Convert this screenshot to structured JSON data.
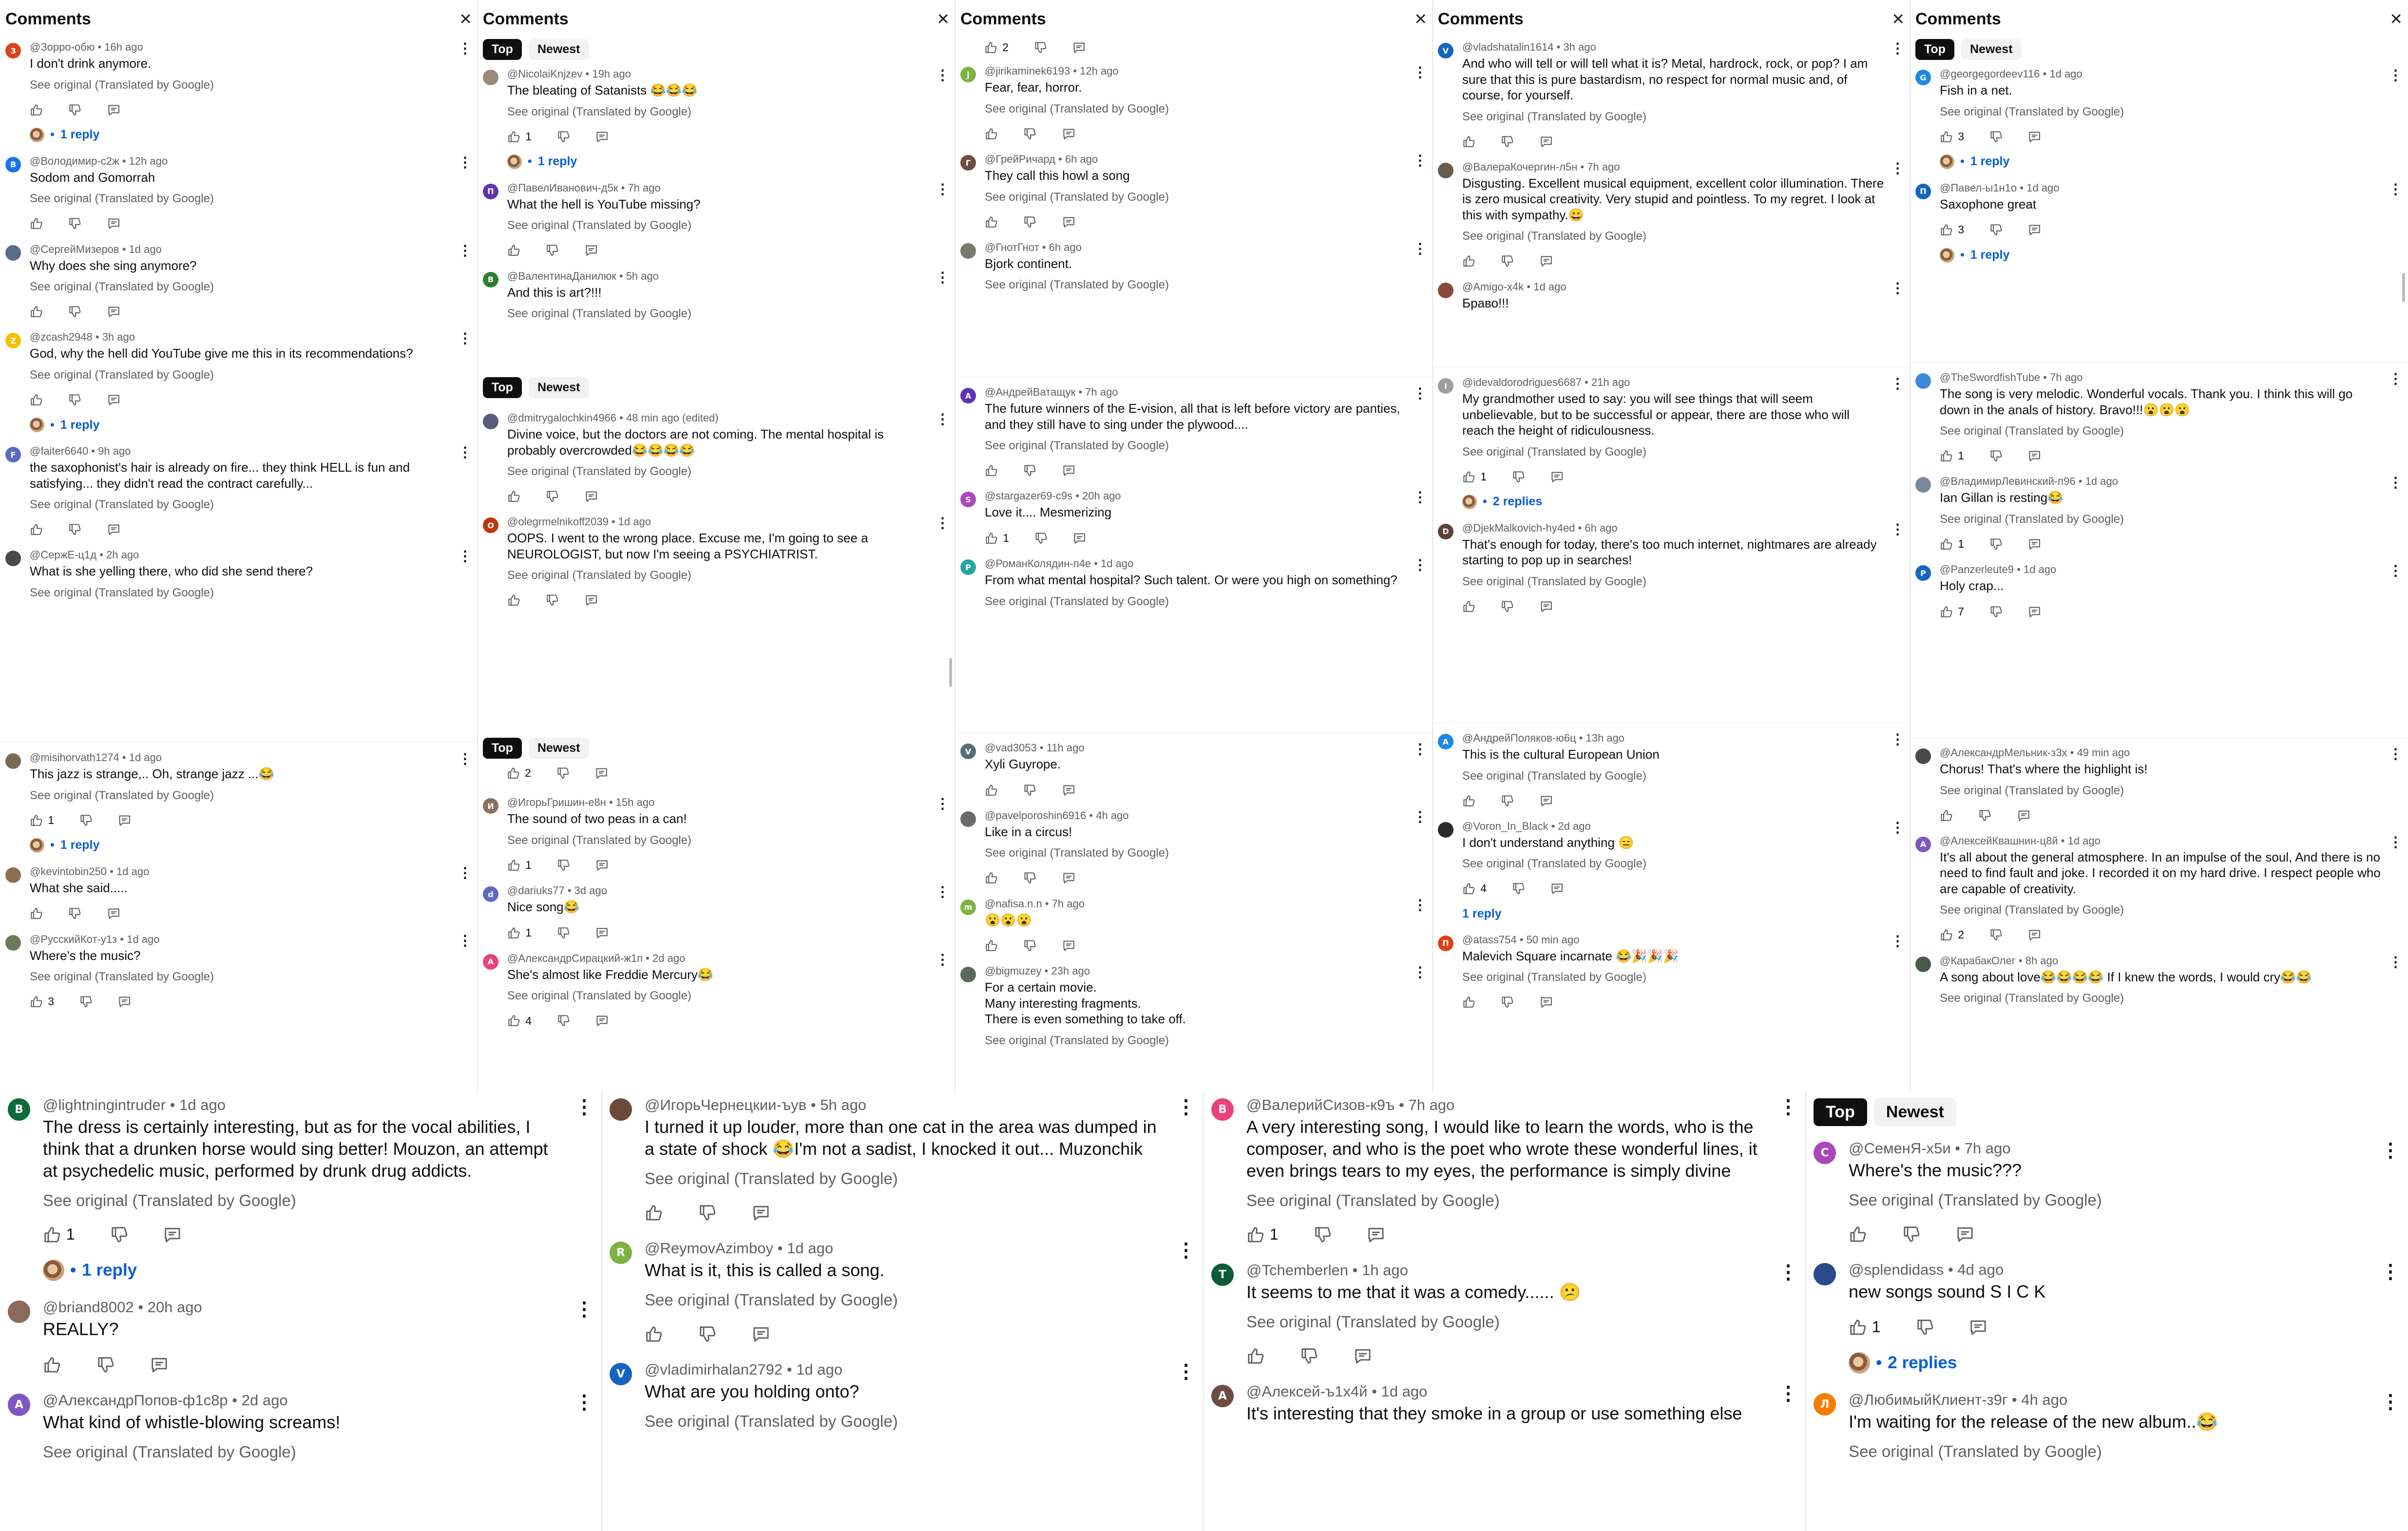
{
  "header": {
    "title": "Comments",
    "tabs": [
      "Top",
      "Newest"
    ]
  },
  "ui": {
    "see_original": "See original (Translated by Google)"
  },
  "accents": {
    "link": "#065fd4",
    "meta": "#606060",
    "active_tab": "#0f0f0f"
  },
  "panels": [
    {
      "comments": [
        {
          "author": "@Зорро-обю",
          "time": "16h ago",
          "text": "I don't drink anymore.",
          "initial": "З",
          "color": "#d9441c",
          "likes": "",
          "replies": "1 reply"
        },
        {
          "author": "@Володимир-с2ж",
          "time": "12h ago",
          "text": "Sodom and Gomorrah",
          "initial": "В",
          "color": "#1a73e8",
          "likes": "",
          "replies": ""
        },
        {
          "author": "@СергейМизеров",
          "time": "1d ago",
          "text": "Why does she sing anymore?",
          "initial": "",
          "color": "#5b6b8a",
          "likes": "",
          "replies": ""
        },
        {
          "author": "@zcash2948",
          "time": "3h ago",
          "text": "God, why the hell did YouTube give me this in its recommendations?",
          "initial": "Z",
          "color": "#f2c200",
          "likes": "",
          "replies": "1 reply"
        },
        {
          "author": "@faiter6640",
          "time": "9h ago",
          "text": "the saxophonist's hair is already on fire... they think HELL is fun and satisfying... they didn't read the contract carefully...",
          "initial": "F",
          "color": "#5c6bc0",
          "likes": "",
          "replies": ""
        },
        {
          "author": "@СержЕ-ц1д",
          "time": "2h ago",
          "text": "What is she yelling there, who did she send there?",
          "initial": "",
          "color": "#4a4a4a",
          "likes": "",
          "replies": "",
          "no_actions": true
        }
      ]
    },
    {
      "comments": [
        {
          "author": "@misihorvath1274",
          "time": "1d ago",
          "text": "This jazz is strange,.. Oh, strange jazz ...😂",
          "initial": "",
          "color": "#7a6a55",
          "likes": "1",
          "replies": "1 reply"
        },
        {
          "author": "@kevintobin250",
          "time": "1d ago",
          "text": "What she said.....",
          "initial": "",
          "color": "#8a7050",
          "likes": "",
          "replies": "",
          "no_see": true
        },
        {
          "author": "@РусскийКот-у1з",
          "time": "1d ago",
          "text": "Where's the music?",
          "initial": "",
          "color": "#6b7b5a",
          "likes": "3",
          "replies": ""
        }
      ]
    },
    {
      "comments": [
        {
          "author": "@NicolaiKnjzev",
          "time": "19h ago",
          "text": "The bleating of Satanists 😂😂😂",
          "initial": "",
          "color": "#9a8a7a",
          "likes": "1",
          "replies": "1 reply"
        },
        {
          "author": "@ПавелИванович-д5к",
          "time": "7h ago",
          "text": "What the hell is YouTube missing?",
          "initial": "П",
          "color": "#5e35b1",
          "likes": "",
          "replies": ""
        },
        {
          "author": "@ВалентинаДанилюк",
          "time": "5h ago",
          "text": "And this is art?!!!",
          "initial": "В",
          "color": "#2e7d32",
          "likes": "",
          "replies": "",
          "no_actions": true
        }
      ]
    },
    {
      "comments": [
        {
          "author": "@dmitrygalochkin4966",
          "time": "48 min ago (edited)",
          "text": "Divine voice, but the doctors are not coming. The mental hospital is probably overcrowded😂😂😂😂",
          "initial": "",
          "color": "#5a5a7a",
          "likes": "",
          "replies": ""
        },
        {
          "author": "@olegrmelnikoff2039",
          "time": "1d ago",
          "text": "OOPS. I went to the wrong place. Excuse me, I'm going to see a NEUROLOGIST, but now I'm seeing a PSYCHIATRIST.",
          "initial": "O",
          "color": "#bf360c",
          "likes": "",
          "replies": ""
        }
      ]
    },
    {
      "top_likes": "2",
      "comments": [
        {
          "author": "@ИгорьГришин-е8н",
          "time": "15h ago",
          "text": "The sound of two peas in a can!",
          "initial": "И",
          "color": "#8d6e63",
          "likes": "1",
          "replies": ""
        },
        {
          "author": "@dariuks77",
          "time": "3d ago",
          "text": "Nice song😂",
          "initial": "d",
          "color": "#5c6bc0",
          "likes": "1",
          "replies": "",
          "no_see": true
        },
        {
          "author": "@АлександрСирацкий-ж1п",
          "time": "2d ago",
          "text": "She's almost like Freddie Mercury😂",
          "initial": "А",
          "color": "#ec407a",
          "likes": "4",
          "replies": ""
        }
      ]
    },
    {
      "top_likes": "2",
      "comments": [
        {
          "author": "@jirikaminek6193",
          "time": "12h ago",
          "text": "Fear, fear, horror.",
          "initial": "j",
          "color": "#7cb342",
          "likes": "",
          "replies": ""
        },
        {
          "author": "@ГрейРичард",
          "time": "6h ago",
          "text": "They call this howl a song",
          "initial": "Г",
          "color": "#6d4c41",
          "likes": "",
          "replies": ""
        },
        {
          "author": "@ГнотГнот",
          "time": "6h ago",
          "text": "Bjork continent.",
          "initial": "",
          "color": "#7a7a6a",
          "likes": "",
          "replies": "",
          "no_actions": true
        }
      ]
    },
    {
      "comments": [
        {
          "author": "@АндрейВатащук",
          "time": "7h ago",
          "text": "The future winners of the E-vision, all that is left before victory are panties, and they still have to sing under the plywood....",
          "initial": "А",
          "color": "#5e35b1",
          "likes": "",
          "replies": ""
        },
        {
          "author": "@stargazer69-c9s",
          "time": "20h ago",
          "text": "Love it....      Mesmerizing",
          "initial": "S",
          "color": "#ab47bc",
          "likes": "1",
          "replies": "",
          "no_see": true
        },
        {
          "author": "@РоманКолядин-п4е",
          "time": "1d ago",
          "text": "From what mental hospital? Such talent. Or were you high on something?",
          "initial": "Р",
          "color": "#26a69a",
          "likes": "",
          "replies": "",
          "no_actions": true
        }
      ]
    },
    {
      "comments": [
        {
          "author": "@vad3053",
          "time": "11h ago",
          "text": "Xyli Guyrope.",
          "initial": "V",
          "color": "#546e7a",
          "likes": "",
          "replies": "",
          "no_see": true
        },
        {
          "author": "@pavelporoshin6916",
          "time": "4h ago",
          "text": "Like in a circus!",
          "initial": "",
          "color": "#6a6a6a",
          "likes": "",
          "replies": ""
        },
        {
          "author": "@nafisa.n.n",
          "time": "7h ago",
          "text": "😮😮😮",
          "initial": "m",
          "color": "#7cb342",
          "likes": "",
          "replies": "",
          "no_see": true
        },
        {
          "author": "@bigmuzey",
          "time": "23h ago",
          "text": "For a certain movie.\nMany interesting fragments.\nThere is even something to take off.",
          "initial": "",
          "color": "#5a6a5a",
          "likes": "",
          "replies": "",
          "no_actions": true
        }
      ]
    },
    {
      "comments": [
        {
          "author": "@vladshatalin1614",
          "time": "3h ago",
          "text": "And who will tell or will tell what it is? Metal, hardrock, rock, or pop? I am sure that this is pure bastardism, no respect for normal music and, of course, for yourself.",
          "initial": "V",
          "color": "#1565c0",
          "likes": "",
          "replies": ""
        },
        {
          "author": "@ВалераКочергин-л5н",
          "time": "7h ago",
          "text": "Disgusting. Excellent musical equipment, excellent color illumination. There is zero musical creativity. Very stupid and pointless. To my regret. I look at this with sympathy.😀",
          "initial": "",
          "color": "#6a5a4a",
          "likes": "",
          "replies": ""
        },
        {
          "author": "@Amigo-x4k",
          "time": "1d ago",
          "text": "Браво!!!",
          "initial": "",
          "color": "#8a4a3a",
          "likes": "",
          "replies": "",
          "no_see": true,
          "no_actions": true
        }
      ]
    },
    {
      "comments": [
        {
          "author": "@idevaldorodrigues6687",
          "time": "21h ago",
          "text": "My grandmother used to say: you will see things that will seem unbelievable, but to be successful or appear, there are those who will reach the height of ridiculousness.",
          "initial": "I",
          "color": "#9e9e9e",
          "likes": "1",
          "replies": "2 replies"
        },
        {
          "author": "@DjekMalkovich-hy4ed",
          "time": "6h ago",
          "text": "That's enough for today, there's too much internet, nightmares are already starting to pop up in searches!",
          "initial": "D",
          "color": "#5d4037",
          "likes": "",
          "replies": ""
        }
      ]
    },
    {
      "comments": [
        {
          "author": "@АндрейПоляков-ю6ц",
          "time": "13h ago",
          "text": "This is the cultural European Union",
          "initial": "А",
          "color": "#1e88e5",
          "likes": "",
          "replies": ""
        },
        {
          "author": "@Voron_In_Black",
          "time": "2d ago",
          "text": "I don't understand anything 😑",
          "initial": "",
          "color": "#2a2a2a",
          "likes": "4",
          "replies": "1 reply",
          "plain_reply": true
        },
        {
          "author": "@atass754",
          "time": "50 min ago",
          "text": "Malevich Square incarnate 😂🎉🎉🎉",
          "initial": "П",
          "color": "#d84315",
          "likes": "",
          "replies": ""
        }
      ]
    },
    {
      "comments": [
        {
          "author": "@georgegordeev116",
          "time": "1d ago",
          "text": "Fish in a net.",
          "initial": "G",
          "color": "#1e88e5",
          "likes": "3",
          "replies": "1 reply"
        },
        {
          "author": "@Павел-ы1н1о",
          "time": "1d ago",
          "text": "Saxophone great",
          "initial": "П",
          "color": "#1565c0",
          "likes": "3",
          "replies": "1 reply",
          "no_see": true
        }
      ]
    },
    {
      "comments": [
        {
          "author": "@TheSwordfishTube",
          "time": "7h ago",
          "text": "The song is very melodic. Wonderful vocals. Thank you. I think this will go down in the anals of history. Bravo!!!😮😮😮",
          "initial": "",
          "color": "#3a8ad8",
          "likes": "1",
          "replies": ""
        },
        {
          "author": "@ВладимирЛевинский-п96",
          "time": "1d ago",
          "text": "Ian Gillan is resting😂",
          "initial": "",
          "color": "#7a8a9a",
          "likes": "1",
          "replies": ""
        },
        {
          "author": "@Panzerleute9",
          "time": "1d ago",
          "text": "Holy crap...",
          "initial": "P",
          "color": "#1565c0",
          "likes": "7",
          "replies": "",
          "no_see": true
        }
      ]
    },
    {
      "comments": [
        {
          "author": "@АлександрМельник-з3х",
          "time": "49 min ago",
          "text": "Chorus! That's where the highlight is!",
          "initial": "",
          "color": "#4a4a4a",
          "likes": "",
          "replies": ""
        },
        {
          "author": "@АлексейКвашнин-ц8й",
          "time": "1d ago",
          "text": "It's all about the general atmosphere. In an impulse of the soul, And there is no need to find fault and joke. I recorded it on my hard drive.  I respect people who are capable of creativity.",
          "initial": "А",
          "color": "#7e57c2",
          "likes": "2",
          "replies": ""
        },
        {
          "author": "@КарабакОлег",
          "time": "8h ago",
          "text": "A song about love😂😂😂😂 If I knew the words, I would cry😂😂",
          "initial": "",
          "color": "#4a5a4a",
          "likes": "",
          "replies": "",
          "no_actions": true
        }
      ]
    },
    {
      "comments": [
        {
          "author": "@lightningintruder",
          "time": "1d ago",
          "text": "The dress is certainly interesting, but as for the vocal abilities, I think that a drunken horse would sing better! Mouzon, an attempt at psychedelic music, performed by drunk drug addicts.",
          "initial": "B",
          "color": "#0d6b3a",
          "likes": "1",
          "replies": "1 reply"
        },
        {
          "author": "@briand8002",
          "time": "20h ago",
          "text": "REALLY?",
          "initial": "",
          "color": "#8a6a5a",
          "likes": "",
          "replies": "",
          "no_see": true
        },
        {
          "author": "@АлександрПопов-ф1с8р",
          "time": "2d ago",
          "text": "What kind of whistle-blowing screams!",
          "initial": "А",
          "color": "#7e57c2",
          "likes": "",
          "replies": "",
          "no_actions": true
        }
      ]
    },
    {
      "comments": [
        {
          "author": "@ИгорьЧернецкии-ъув",
          "time": "5h ago",
          "text": "I turned it up louder, more than one cat in the area was dumped in a state of shock 😂I'm not a sadist, I knocked it out... Muzonchik",
          "initial": "",
          "color": "#6a4a3a",
          "likes": "",
          "replies": ""
        },
        {
          "author": "@ReymovAzimboy",
          "time": "1d ago",
          "text": "What is it, this is called a song.",
          "initial": "R",
          "color": "#7cb342",
          "likes": "",
          "replies": ""
        },
        {
          "author": "@vladimirhalan2792",
          "time": "1d ago",
          "text": "What are you holding onto?",
          "initial": "V",
          "color": "#1565c0",
          "likes": "",
          "replies": "",
          "no_actions": true
        }
      ]
    },
    {
      "comments": [
        {
          "author": "@ВалерийСизов-к9ъ",
          "time": "7h ago",
          "text": "A very interesting song, I would like to learn the words, who is the composer, and who is the poet who wrote these wonderful lines, it even brings tears to my eyes, the performance is simply divine",
          "initial": "В",
          "color": "#ec407a",
          "likes": "1",
          "replies": ""
        },
        {
          "author": "@Tchemberlen",
          "time": "1h ago",
          "text": "It seems to me that it was a comedy...... 😕",
          "initial": "T",
          "color": "#0d5a3a",
          "likes": "",
          "replies": ""
        },
        {
          "author": "@Алексей-ъ1х4й",
          "time": "1d ago",
          "text": "It's interesting that they smoke in a group or use something else",
          "initial": "А",
          "color": "#6d4c41",
          "likes": "",
          "replies": "",
          "no_see": true,
          "no_actions": true
        }
      ]
    },
    {
      "comments": [
        {
          "author": "@СеменЯ-х5и",
          "time": "7h ago",
          "text": "Where's the music???",
          "initial": "С",
          "color": "#ab47bc",
          "likes": "",
          "replies": ""
        },
        {
          "author": "@splendidass",
          "time": "4d ago",
          "text": "new songs sound S I C K",
          "initial": "",
          "color": "#2a4a8a",
          "likes": "1",
          "replies": "2 replies",
          "no_see": true
        },
        {
          "author": "@ЛюбимыйКлиент-з9г",
          "time": "4h ago",
          "text": "I'm waiting for the release of the new album..😂",
          "initial": "Л",
          "color": "#f57c00",
          "likes": "",
          "replies": "",
          "no_actions": true
        }
      ]
    }
  ]
}
